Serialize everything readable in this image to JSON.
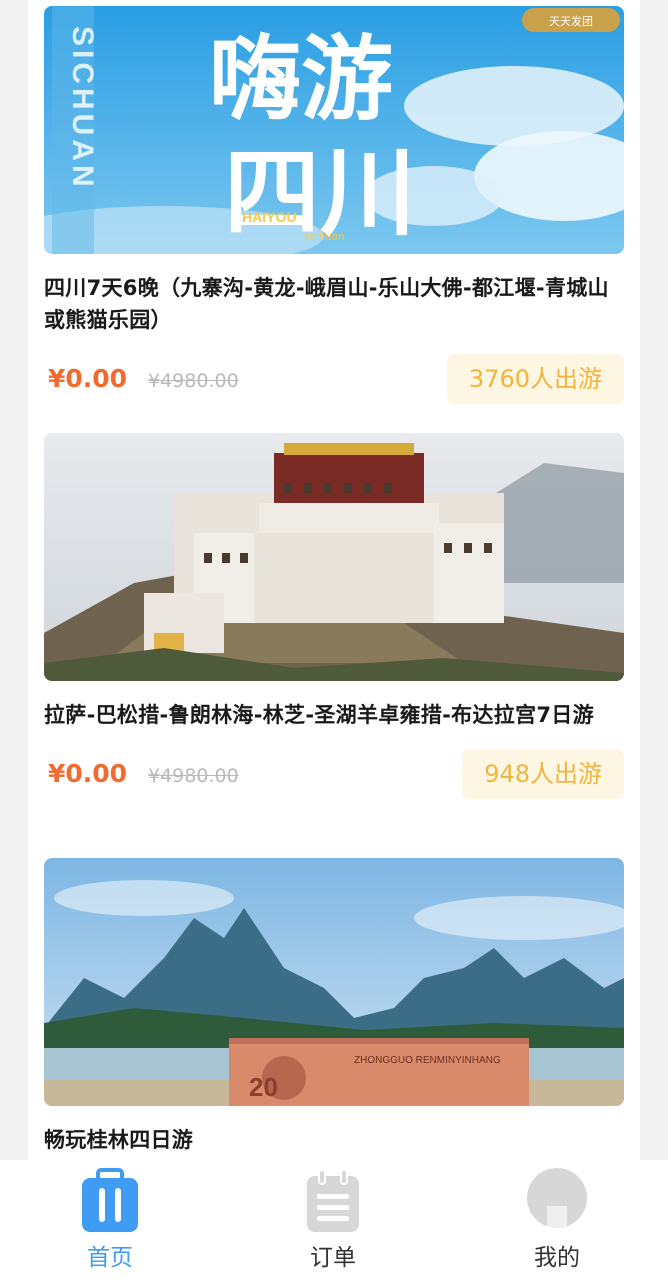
{
  "products": [
    {
      "image_label": "Sichuan travel poster",
      "poster_text": {
        "big": [
          "嗨游",
          "四川"
        ],
        "vertical": "SICHUAN",
        "sub_top": "HAIYOU",
        "sub_bottom": "sichuan",
        "stamp": "天天发团"
      },
      "title": "四川7天6晚（九寨沟-黄龙-峨眉山-乐山大佛-都江堰-青城山或熊猫乐园）",
      "price": "¥0.00",
      "original_price": "¥4980.00",
      "travelers": "3760人出游"
    },
    {
      "image_label": "Potala Palace photo",
      "title": "拉萨-巴松措-鲁朗林海-林芝-圣湖羊卓雍措-布达拉宫7日游",
      "price": "¥0.00",
      "original_price": "¥4980.00",
      "travelers": "948人出游"
    },
    {
      "image_label": "Guilin landscape photo",
      "banknote_text": "ZHONGGUO RENMINYINHANG",
      "banknote_value": "20",
      "title": "畅玩桂林四日游"
    }
  ],
  "tabbar": {
    "items": [
      {
        "label": "首页",
        "icon": "suitcase-icon",
        "active": true
      },
      {
        "label": "订单",
        "icon": "clipboard-icon",
        "active": false
      },
      {
        "label": "我的",
        "icon": "user-avatar-icon",
        "active": false
      }
    ]
  },
  "colors": {
    "price": "#f26a2e",
    "badge_text": "#f2b43d",
    "badge_bg": "#fdf6e3",
    "active_tab": "#3f9cf2",
    "inactive_icon": "#d7d7d7"
  }
}
